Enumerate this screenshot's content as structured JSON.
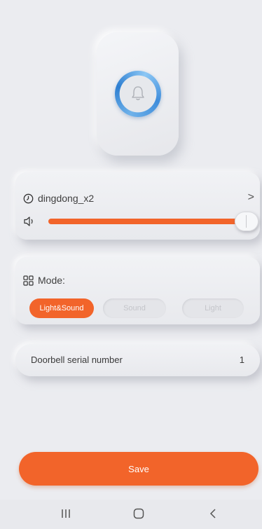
{
  "ringtone": {
    "name": "dingdong_x2",
    "volume_fraction": 1.0
  },
  "mode": {
    "label": "Mode:",
    "options": [
      "Light&Sound",
      "Sound",
      "Light"
    ],
    "selected": "Light&Sound"
  },
  "serial": {
    "label": "Doorbell serial number",
    "value": "1"
  },
  "save": {
    "label": "Save"
  },
  "colors": {
    "accent": "#f2642a",
    "bell_ring": "#3f8ddb",
    "background": "#ebecf0"
  },
  "icons": {
    "ringtone": "clock-icon",
    "volume": "speaker-icon",
    "mode": "grid-icon",
    "chevron": "chevron-right-icon",
    "bell": "bell-icon"
  }
}
